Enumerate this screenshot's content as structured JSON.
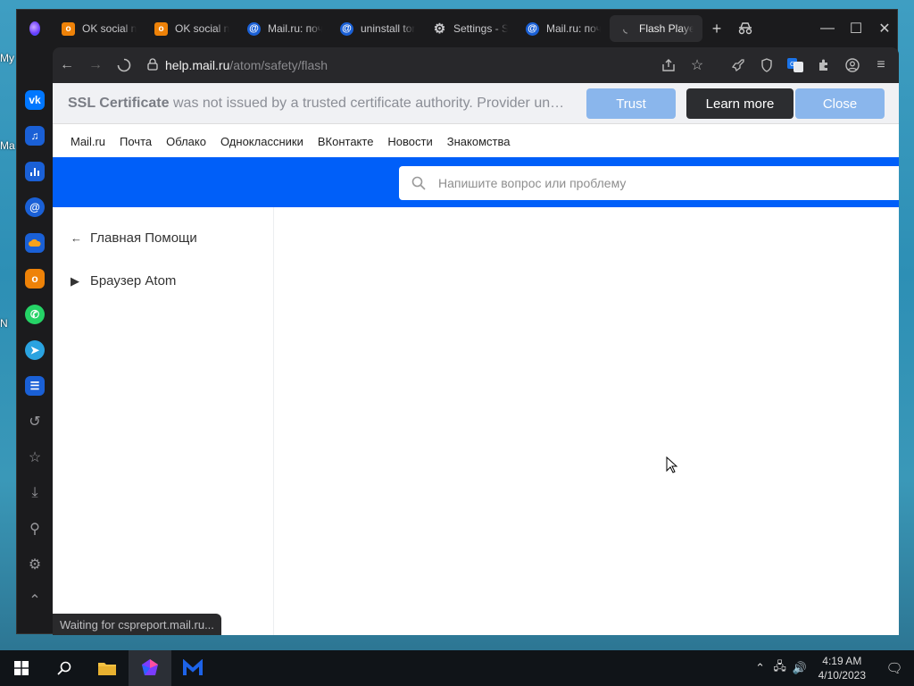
{
  "desktop": {
    "ghosts": [
      "My",
      "Ma",
      "N"
    ]
  },
  "tabs": [
    {
      "label": "OK social ne",
      "icon": "ok-icon"
    },
    {
      "label": "OK social ne",
      "icon": "ok-icon"
    },
    {
      "label": "Mail.ru: поч",
      "icon": "mail-icon"
    },
    {
      "label": "uninstall tor",
      "icon": "mail-icon"
    },
    {
      "label": "Settings - S",
      "icon": "gear-icon"
    },
    {
      "label": "Mail.ru: поч",
      "icon": "mail-icon"
    },
    {
      "label": "Flash Player",
      "icon": "loading-icon",
      "active": true
    }
  ],
  "address": {
    "host": "help.mail.ru",
    "path": "/atom/safety/flash"
  },
  "ssl": {
    "title": "SSL Certificate",
    "message": "was not issued by a trusted certificate authority. Provider unknown",
    "trust": "Trust",
    "learn_more": "Learn more",
    "close": "Close"
  },
  "topnav": [
    "Mail.ru",
    "Почта",
    "Облако",
    "Одноклассники",
    "ВКонтакте",
    "Новости",
    "Знакомства"
  ],
  "search": {
    "placeholder": "Напишите вопрос или проблему"
  },
  "leftnav": {
    "home": "Главная Помощи",
    "section": "Браузер Atom"
  },
  "status": "Waiting for cspreport.mail.ru...",
  "clock": {
    "time": "4:19 AM",
    "date": "4/10/2023"
  },
  "colors": {
    "accent": "#005ff9",
    "trust": "#8ab6ec",
    "ok": "#ee8208",
    "mail": "#1a60d6"
  }
}
